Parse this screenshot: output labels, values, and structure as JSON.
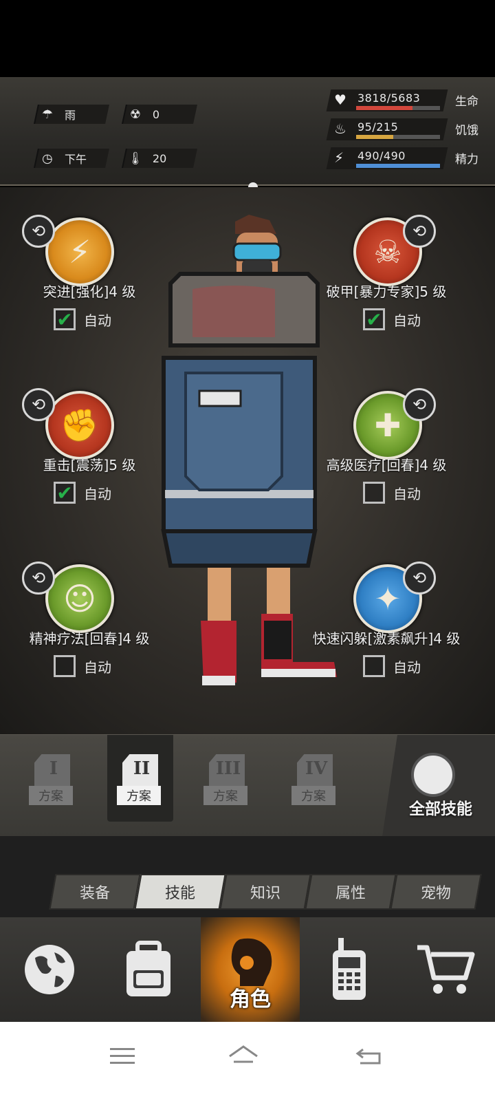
{
  "status": {
    "weather": {
      "icon": "rain-cloud-icon",
      "label": "雨"
    },
    "radiation": {
      "icon": "radiation-icon",
      "value": "0"
    },
    "time": {
      "icon": "clock-icon",
      "label": "下午"
    },
    "temperature": {
      "icon": "thermometer-icon",
      "value": "20"
    },
    "stats": [
      {
        "key": "health",
        "icon": "heart-icon",
        "value": "3818/5683",
        "label": "生命",
        "fraction": 0.67,
        "color": "#d2473c"
      },
      {
        "key": "hunger",
        "icon": "stomach-icon",
        "value": "95/215",
        "label": "饥饿",
        "fraction": 0.44,
        "color": "#d7a640"
      },
      {
        "key": "energy",
        "icon": "lightning-icon",
        "value": "490/490",
        "label": "精力",
        "fraction": 1.0,
        "color": "#4f8fd6"
      }
    ]
  },
  "skills": [
    {
      "name": "突进[强化]4 级",
      "icon": "sprint-icon",
      "auto": true,
      "auto_label": "自动",
      "color": "#d98a1c"
    },
    {
      "name": "破甲[暴力专家]5 级",
      "icon": "skull-crossbones-icon",
      "auto": true,
      "auto_label": "自动",
      "color": "#b5361f"
    },
    {
      "name": "重击[震荡]5 级",
      "icon": "heavy-strike-icon",
      "auto": true,
      "auto_label": "自动",
      "color": "#b5361f"
    },
    {
      "name": "高级医疗[回春]4 级",
      "icon": "medkit-icon",
      "auto": false,
      "auto_label": "自动",
      "color": "#6a9a2a"
    },
    {
      "name": "精神疗法[回春]4 级",
      "icon": "meditation-icon",
      "auto": false,
      "auto_label": "自动",
      "color": "#6a9a2a"
    },
    {
      "name": "快速闪躲[激素飙升]4 级",
      "icon": "dodge-icon",
      "auto": false,
      "auto_label": "自动",
      "color": "#2f7fc4"
    }
  ],
  "plans": [
    {
      "numeral": "I",
      "label": "方案",
      "active": false
    },
    {
      "numeral": "II",
      "label": "方案",
      "active": true
    },
    {
      "numeral": "III",
      "label": "方案",
      "active": false
    },
    {
      "numeral": "IV",
      "label": "方案",
      "active": false
    }
  ],
  "all_skills_label": "全部技能",
  "tabs": [
    {
      "label": "装备",
      "active": false
    },
    {
      "label": "技能",
      "active": true
    },
    {
      "label": "知识",
      "active": false
    },
    {
      "label": "属性",
      "active": false
    },
    {
      "label": "宠物",
      "active": false
    }
  ],
  "bottom_nav": [
    {
      "key": "world",
      "icon": "globe-icon"
    },
    {
      "key": "backpack",
      "icon": "backpack-icon"
    },
    {
      "key": "character",
      "icon": "character-head-icon",
      "label": "角色",
      "active": true
    },
    {
      "key": "radio",
      "icon": "walkie-talkie-icon"
    },
    {
      "key": "shop",
      "icon": "shopping-cart-icon"
    }
  ]
}
